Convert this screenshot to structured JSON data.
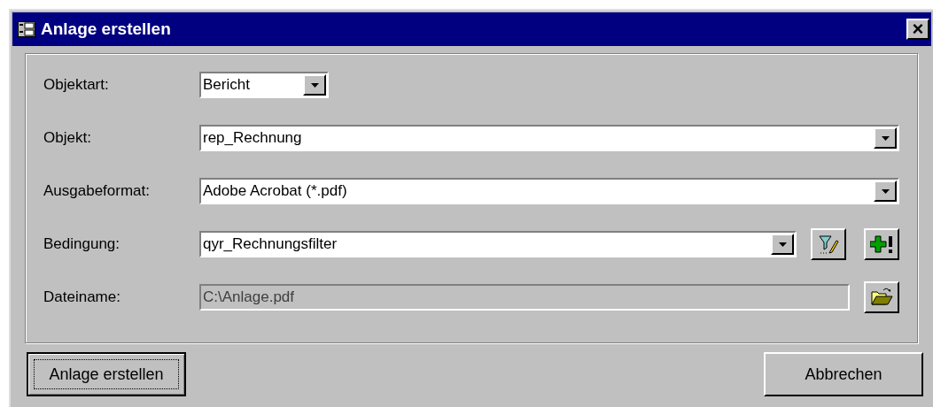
{
  "window": {
    "title": "Anlage erstellen",
    "close": "×"
  },
  "fields": [
    {
      "label": "Objektart:",
      "kind": "small-combo",
      "value": "Bericht",
      "disabled": false
    },
    {
      "label": "Objekt:",
      "kind": "combo",
      "value": "rep_Rechnung",
      "disabled": false
    },
    {
      "label": "Ausgabeformat:",
      "kind": "combo",
      "value": "Adobe Acrobat (*.pdf)",
      "disabled": false
    },
    {
      "label": "Bedingung:",
      "kind": "combo",
      "value": "qyr_Rechnungsfilter",
      "disabled": false,
      "buttons": [
        {
          "kind": "filter"
        },
        {
          "kind": "add"
        }
      ]
    },
    {
      "label": "Dateiname:",
      "kind": "text",
      "value": "C:\\Anlage.pdf",
      "disabled": true,
      "buttons": [
        {
          "kind": "folder"
        }
      ]
    }
  ],
  "buttons": [
    {
      "label": "Anlage erstellen",
      "focused": true
    },
    {
      "label": "Abbrechen",
      "focused": false
    }
  ]
}
